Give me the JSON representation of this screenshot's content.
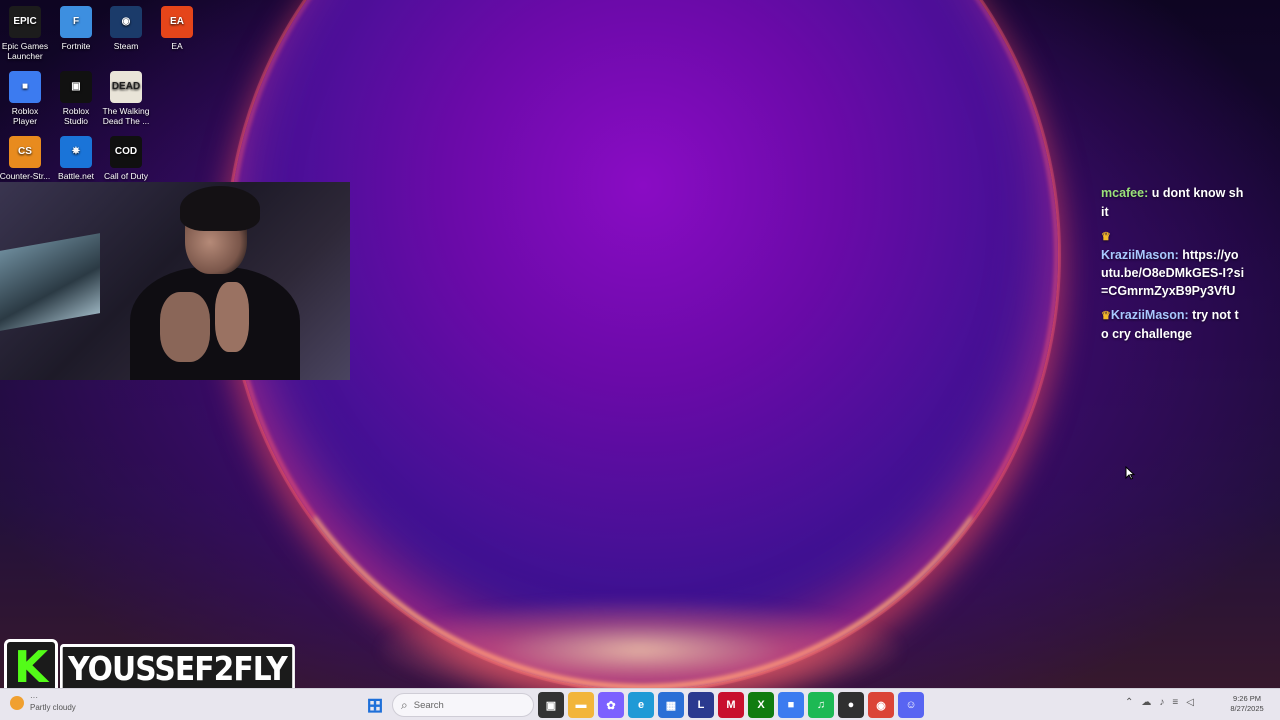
{
  "desktop": {
    "icons": [
      {
        "label": "Epic Games Launcher",
        "glyph": "EPIC",
        "icon": "epic-games-icon",
        "color": "#1c1c1c"
      },
      {
        "label": "Fortnite",
        "glyph": "F",
        "icon": "fortnite-icon",
        "color": "#3d8fe0"
      },
      {
        "label": "Steam",
        "glyph": "◉",
        "icon": "steam-icon",
        "color": "#1b3b6a"
      },
      {
        "label": "EA",
        "glyph": "EA",
        "icon": "ea-icon",
        "color": "#e5451a"
      },
      {
        "label": "Roblox Player",
        "glyph": "■",
        "icon": "roblox-player-icon",
        "color": "#3c7bf0"
      },
      {
        "label": "Roblox Studio",
        "glyph": "▣",
        "icon": "roblox-studio-icon",
        "color": "#111111"
      },
      {
        "label": "The Walking Dead The ...",
        "glyph": "DEAD",
        "icon": "walking-dead-icon",
        "color": "#e9e4d8"
      },
      {
        "label": "Counter-Str...",
        "glyph": "CS",
        "icon": "counter-strike-icon",
        "color": "#e88b1e"
      },
      {
        "label": "Battle.net",
        "glyph": "✵",
        "icon": "battle-net-icon",
        "color": "#1a74d8"
      },
      {
        "label": "Call of Duty",
        "glyph": "COD",
        "icon": "call-of-duty-icon",
        "color": "#101010"
      }
    ]
  },
  "chat": {
    "messages": [
      {
        "crown": "",
        "user": "mcafee",
        "text": "u dont know shit",
        "user_color": "green"
      },
      {
        "crown": "♛",
        "user": "KraziiMason",
        "text": "https://youtu.be/O8eDMkGES-I?si=CGmrmZyxB9Py3VfU",
        "user_color": "blue"
      },
      {
        "crown": "♛",
        "user": "KraziiMason",
        "text": "try not to cry challenge",
        "user_color": "blue"
      }
    ]
  },
  "overlay": {
    "logo_letter": "K",
    "streamer_name": "YOUSSEF2FLY"
  },
  "taskbar": {
    "weather_top": "···",
    "weather_text": "Partly cloudy",
    "search_placeholder": "Search",
    "apps": [
      {
        "icon": "windows-start-icon",
        "glyph": "⊞",
        "color": "#1e6fd9"
      },
      {
        "icon": "task-view-icon",
        "glyph": "▣",
        "color": "#333333"
      },
      {
        "icon": "file-explorer-icon",
        "glyph": "▬",
        "color": "#f2b53a"
      },
      {
        "icon": "copilot-icon",
        "glyph": "✿",
        "color": "#7b61ff"
      },
      {
        "icon": "edge-icon",
        "glyph": "e",
        "color": "#1f9ad6"
      },
      {
        "icon": "store-icon",
        "glyph": "▦",
        "color": "#2a6fd6"
      },
      {
        "icon": "lightshot-icon",
        "glyph": "L",
        "color": "#2b3a8f"
      },
      {
        "icon": "mcafee-icon",
        "glyph": "M",
        "color": "#c8102e"
      },
      {
        "icon": "xbox-icon",
        "glyph": "X",
        "color": "#107c10"
      },
      {
        "icon": "roblox-taskbar-icon",
        "glyph": "■",
        "color": "#3c7bf0"
      },
      {
        "icon": "spotify-icon",
        "glyph": "♫",
        "color": "#1db954"
      },
      {
        "icon": "obs-icon",
        "glyph": "●",
        "color": "#303030"
      },
      {
        "icon": "chrome-icon",
        "glyph": "◉",
        "color": "#db4437"
      },
      {
        "icon": "discord-icon",
        "glyph": "☺",
        "color": "#5865f2"
      }
    ],
    "tray": [
      "⌃",
      "☁",
      "♪",
      "≡",
      "◁"
    ],
    "time": "9:26 PM",
    "date": "8/27/2025"
  }
}
